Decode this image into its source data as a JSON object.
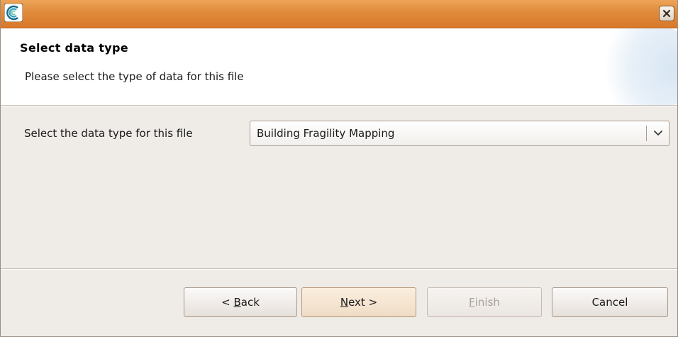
{
  "titlebar": {
    "icon": "app-logo-icon",
    "close_icon": "close-icon"
  },
  "banner": {
    "title": "Select data type",
    "description": "Please select the type of data for this file"
  },
  "form": {
    "data_type_label": "Select the data type for this file",
    "data_type_value": "Building Fragility Mapping",
    "dropdown_icon": "chevron-down-icon"
  },
  "buttons": {
    "back": {
      "prefix": "< ",
      "mnemonic": "B",
      "rest": "ack"
    },
    "next": {
      "mnemonic": "N",
      "rest": "ext >"
    },
    "finish": {
      "mnemonic": "F",
      "rest": "inish",
      "enabled": false
    },
    "cancel": "Cancel"
  },
  "colors": {
    "titlebar": "#e08a3a",
    "background": "#efebe7",
    "default_button": "#f5e6d3"
  }
}
